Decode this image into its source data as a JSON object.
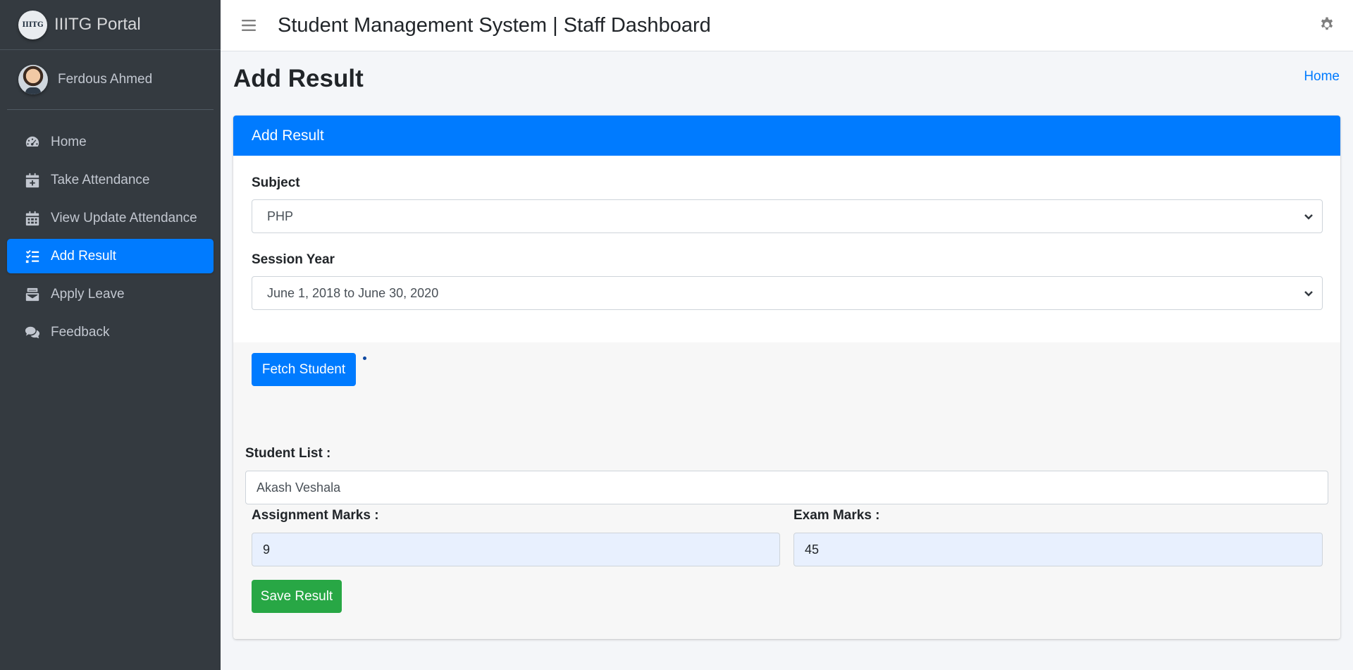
{
  "brand": {
    "logo_text": "IIITG",
    "name": "IIITG Portal"
  },
  "user": {
    "name": "Ferdous Ahmed"
  },
  "sidebar": {
    "items": [
      {
        "label": "Home",
        "icon": "dashboard-icon",
        "active": false
      },
      {
        "label": "Take Attendance",
        "icon": "calendar-plus-icon",
        "active": false
      },
      {
        "label": "View Update Attendance",
        "icon": "calendar-icon",
        "active": false
      },
      {
        "label": "Add Result",
        "icon": "tasks-icon",
        "active": true
      },
      {
        "label": "Apply Leave",
        "icon": "mail-bulk-icon",
        "active": false
      },
      {
        "label": "Feedback",
        "icon": "comments-icon",
        "active": false
      }
    ]
  },
  "header": {
    "title": "Student Management System | Staff Dashboard"
  },
  "page": {
    "title": "Add Result",
    "breadcrumb_home": "Home"
  },
  "card": {
    "header": "Add Result",
    "subject_label": "Subject",
    "subject_value": "PHP",
    "session_label": "Session Year",
    "session_value": "June 1, 2018 to June 30, 2020",
    "fetch_button": "Fetch Student",
    "student_list_label": "Student List :",
    "student_value": "Akash Veshala",
    "assignment_label": "Assignment Marks :",
    "assignment_value": "9",
    "exam_label": "Exam Marks :",
    "exam_value": "45",
    "save_button": "Save Result"
  },
  "colors": {
    "primary": "#007bff",
    "success": "#28a745",
    "sidebar_bg": "#343a40"
  }
}
